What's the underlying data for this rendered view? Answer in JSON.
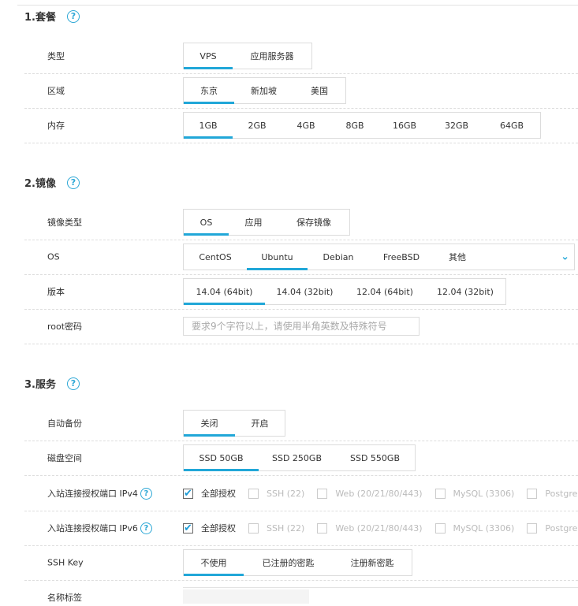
{
  "sections": {
    "plan": "1.套餐",
    "image": "2.镜像",
    "service": "3.服务"
  },
  "help_icon_text": "?",
  "type": {
    "label": "类型",
    "options": [
      "VPS",
      "应用服务器"
    ],
    "selected": "VPS"
  },
  "region": {
    "label": "区域",
    "options": [
      "东京",
      "新加坡",
      "美国"
    ],
    "selected": "东京"
  },
  "memory": {
    "label": "内存",
    "options": [
      "1GB",
      "2GB",
      "4GB",
      "8GB",
      "16GB",
      "32GB",
      "64GB"
    ],
    "selected": "1GB"
  },
  "image_type": {
    "label": "镜像类型",
    "options": [
      "OS",
      "应用",
      "保存镜像"
    ],
    "selected": "OS"
  },
  "os": {
    "label": "OS",
    "options": [
      "CentOS",
      "Ubuntu",
      "Debian",
      "FreeBSD",
      "其他"
    ],
    "selected": "Ubuntu"
  },
  "version": {
    "label": "版本",
    "options": [
      "14.04 (64bit)",
      "14.04 (32bit)",
      "12.04 (64bit)",
      "12.04 (32bit)"
    ],
    "selected": "14.04 (64bit)"
  },
  "root_password": {
    "label": "root密码",
    "placeholder": "要求9个字符以上，请使用半角英数及特殊符号"
  },
  "auto_backup": {
    "label": "自动备份",
    "options": [
      "关闭",
      "开启"
    ],
    "selected": "关闭"
  },
  "disk": {
    "label": "磁盘空间",
    "options": [
      "SSD 50GB",
      "SSD 250GB",
      "SSD 550GB"
    ],
    "selected": "SSD 50GB"
  },
  "ipv4": {
    "label": "入站连接授权端口 IPv4",
    "options": [
      {
        "text": "全部授权",
        "checked": true
      },
      {
        "text": "SSH (22)",
        "checked": false
      },
      {
        "text": "Web (20/21/80/443)",
        "checked": false
      },
      {
        "text": "MySQL (3306)",
        "checked": false
      },
      {
        "text": "PostgreS",
        "checked": false
      }
    ]
  },
  "ipv6": {
    "label": "入站连接授权端口 IPv6",
    "options": [
      {
        "text": "全部授权",
        "checked": true
      },
      {
        "text": "SSH (22)",
        "checked": false
      },
      {
        "text": "Web (20/21/80/443)",
        "checked": false
      },
      {
        "text": "MySQL (3306)",
        "checked": false
      },
      {
        "text": "PostgreS",
        "checked": false
      }
    ]
  },
  "ssh_key": {
    "label": "SSH Key",
    "options": [
      "不使用",
      "已注册的密匙",
      "注册新密匙"
    ],
    "selected": "不使用"
  },
  "name_tag": {
    "label": "名称标签"
  },
  "colors": {
    "accent": "#21a7d8",
    "border": "#dcdcdc"
  }
}
